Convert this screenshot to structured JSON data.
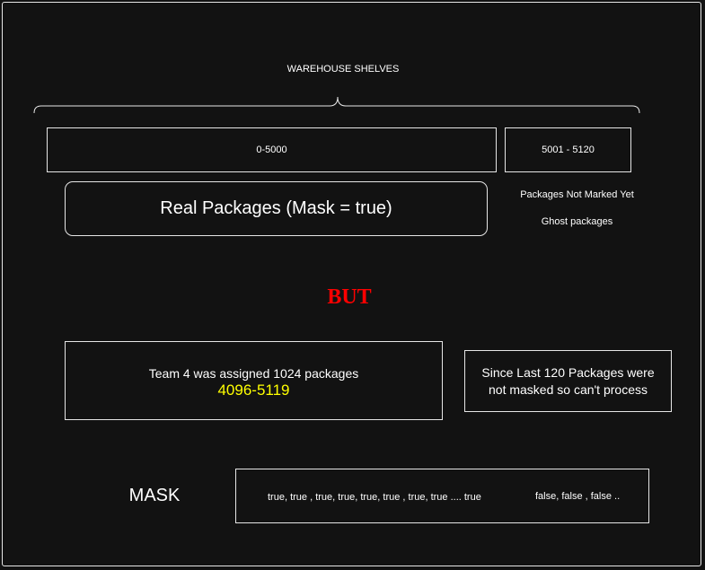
{
  "colors": {
    "background": "#121212",
    "stroke": "#e6e6e6",
    "alert": "#ff0000",
    "highlight": "#ffff00"
  },
  "header": {
    "title": "WAREHOUSE SHELVES"
  },
  "shelves": {
    "range_a": "0-5000",
    "range_b": "5001 - 5120"
  },
  "real_packages": {
    "label": "Real Packages (Mask = true)"
  },
  "side_notes": {
    "not_marked": "Packages Not Marked Yet",
    "ghost": "Ghost packages"
  },
  "divider": {
    "text": "BUT"
  },
  "team_box": {
    "line1": "Team 4 was assigned 1024 packages",
    "range": "4096-5119"
  },
  "problem_box": {
    "line1": "Since Last 120 Packages were",
    "line2": "not masked so can't process"
  },
  "mask": {
    "label": "MASK",
    "true_values": "true, true , true, true, true, true , true, true .... true",
    "false_values": "false, false , false .."
  }
}
